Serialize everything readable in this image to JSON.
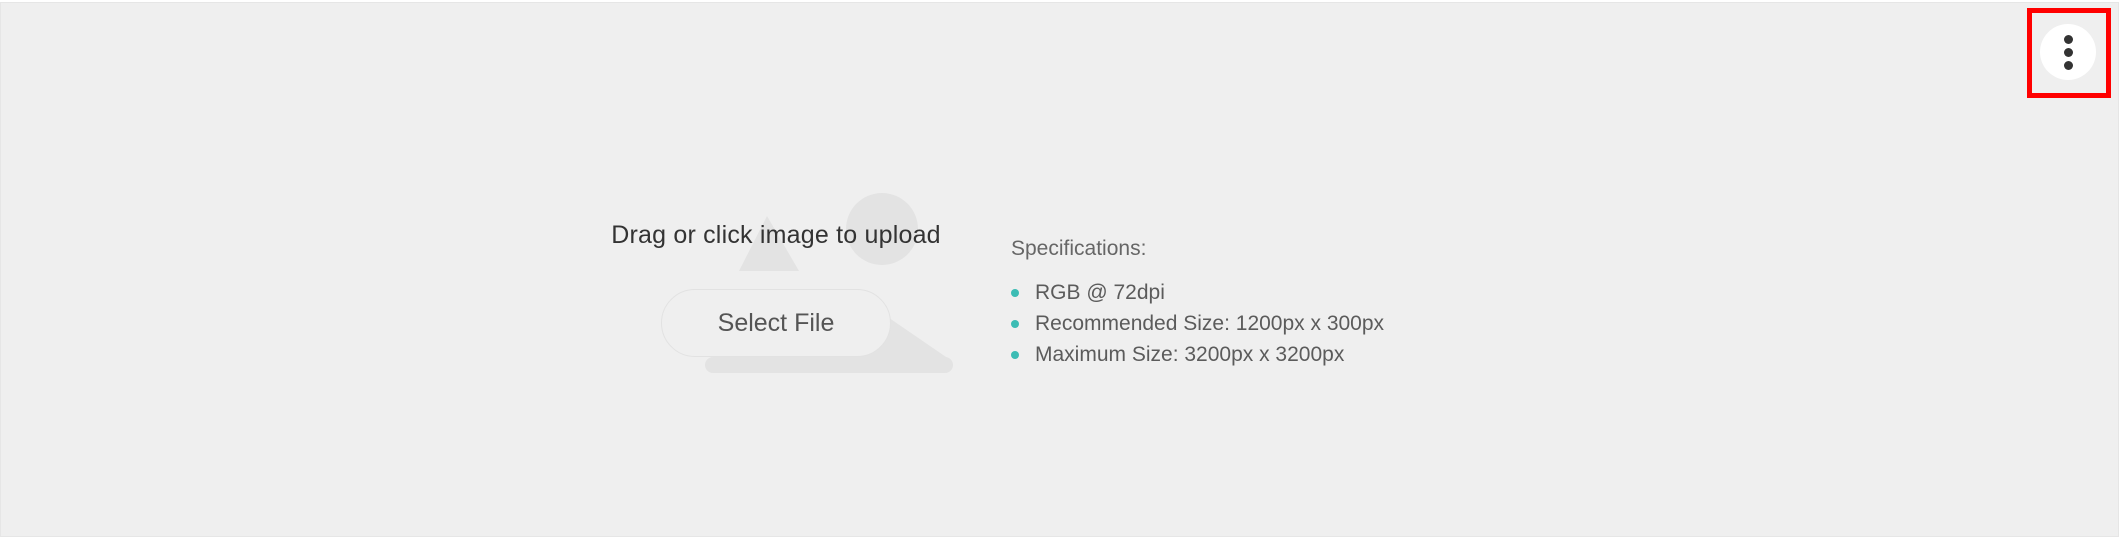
{
  "upload": {
    "title": "Drag or click image to upload",
    "select_label": "Select File"
  },
  "specs": {
    "title": "Specifications:",
    "items": [
      "RGB @ 72dpi",
      "Recommended Size: 1200px x 300px",
      "Maximum Size: 3200px x 3200px"
    ],
    "bullet_color": "#3cbcb4"
  },
  "menu": {
    "icon": "more-vertical-icon"
  },
  "highlight": {
    "color": "#ff0000"
  }
}
